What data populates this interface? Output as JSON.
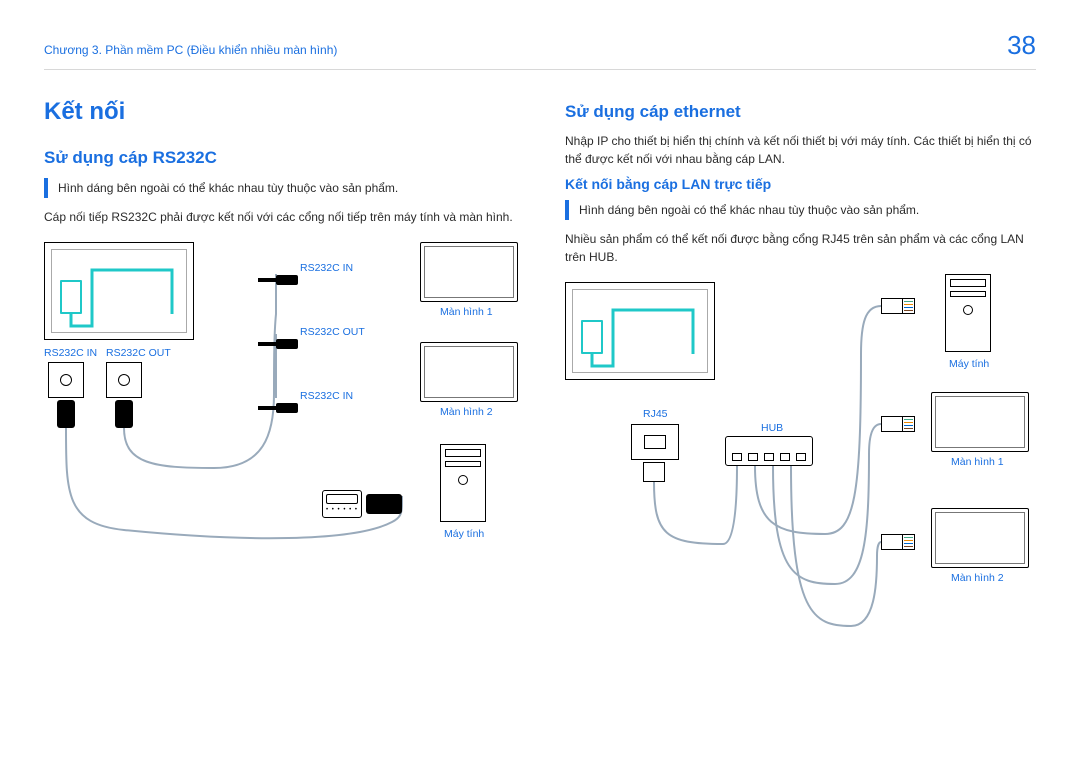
{
  "header": {
    "breadcrumb": "Chương 3. Phần mềm PC (Điều khiển nhiều màn hình)",
    "page_number": "38"
  },
  "left": {
    "section": "Kết nối",
    "sub": "Sử dụng cáp RS232C",
    "note": "Hình dáng bên ngoài có thể khác nhau tùy thuộc vào sản phẩm.",
    "body": "Cáp nối tiếp RS232C phải được kết nối với các cổng nối tiếp trên máy tính và màn hình.",
    "labels": {
      "rs232c_in_1": "RS232C IN",
      "rs232c_out_1": "RS232C OUT",
      "rs232c_in_jack": "RS232C IN",
      "rs232c_out_jack": "RS232C OUT",
      "rs232c_in_jack2": "RS232C IN",
      "monitor1": "Màn hình 1",
      "monitor2": "Màn hình 2",
      "pc": "Máy tính"
    }
  },
  "right": {
    "sub": "Sử dụng cáp ethernet",
    "body1": "Nhập IP cho thiết bị hiển thị chính và kết nối thiết bị với máy tính. Các thiết bị hiển thị có thể được kết nối với nhau bằng cáp LAN.",
    "subsub": "Kết nối bằng cáp LAN trực tiếp",
    "note": "Hình dáng bên ngoài có thể khác nhau tùy thuộc vào sản phẩm.",
    "body2": "Nhiều sản phẩm có thể kết nối được bằng cổng RJ45 trên sản phẩm và các cổng LAN trên HUB.",
    "labels": {
      "rj45": "RJ45",
      "hub": "HUB",
      "pc": "Máy tính",
      "monitor1": "Màn hình 1",
      "monitor2": "Màn hình 2"
    }
  }
}
